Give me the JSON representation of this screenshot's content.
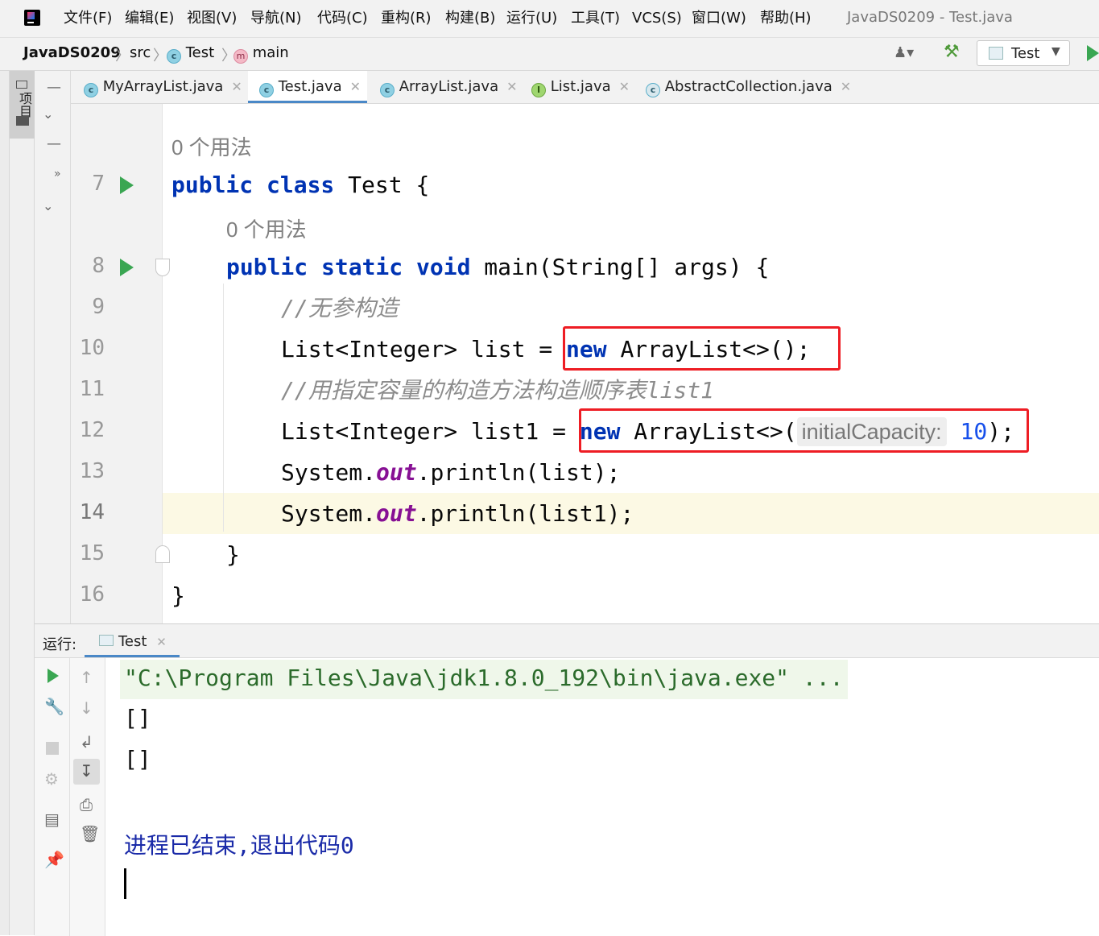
{
  "menubar": {
    "items": [
      "文件(F)",
      "编辑(E)",
      "视图(V)",
      "导航(N)",
      "代码(C)",
      "重构(R)",
      "构建(B)",
      "运行(U)",
      "工具(T)",
      "VCS(S)",
      "窗口(W)",
      "帮助(H)"
    ],
    "window_title": "JavaDS0209 - Test.java"
  },
  "breadcrumb": {
    "project": "JavaDS0209",
    "src": "src",
    "class": "Test",
    "method": "main"
  },
  "toolbar": {
    "run_config": "Test"
  },
  "side_panel": {
    "project_tab": "项目"
  },
  "tabs": [
    {
      "label": "MyArrayList.java",
      "icon": "class-icon",
      "active": false
    },
    {
      "label": "Test.java",
      "icon": "class-icon",
      "active": true
    },
    {
      "label": "ArrayList.java",
      "icon": "class-icon",
      "active": false
    },
    {
      "label": "List.java",
      "icon": "interface-icon",
      "active": false
    },
    {
      "label": "AbstractCollection.java",
      "icon": "abstract-class-icon",
      "active": false
    }
  ],
  "editor": {
    "usage_hint": "0 个用法",
    "line_numbers": [
      "7",
      "8",
      "9",
      "10",
      "11",
      "12",
      "13",
      "14",
      "15",
      "16"
    ],
    "current_line": "14",
    "param_hint": "initialCapacity:",
    "lines": {
      "l7_kw": "public class",
      "l7_rest": " Test {",
      "l8_kw": "public static void",
      "l8_rest": " main(String[] args) {",
      "l9_comment": "//无参构造",
      "l10_a": "List<Integer> list = ",
      "l10_kw": "new",
      "l10_b": " ArrayList<>();",
      "l11_comment": "//用指定容量的构造方法构造顺序表list1",
      "l12_a": "List<Integer> list1 = ",
      "l12_kw": "new",
      "l12_b": " ArrayList<>(",
      "l12_num": "10",
      "l12_c": ");",
      "l13_a": "System.",
      "l13_fld": "out",
      "l13_b": ".println(list);",
      "l14_a": "System.",
      "l14_fld": "out",
      "l14_b": ".println(list1);",
      "l15": "}",
      "l16": "}"
    },
    "highlight_color": "#ee1d24"
  },
  "run_panel": {
    "label": "运行:",
    "tab": "Test",
    "output": [
      "\"C:\\Program Files\\Java\\jdk1.8.0_192\\bin\\java.exe\" ...",
      "[]",
      "[]",
      "",
      "进程已结束,退出代码0"
    ]
  }
}
